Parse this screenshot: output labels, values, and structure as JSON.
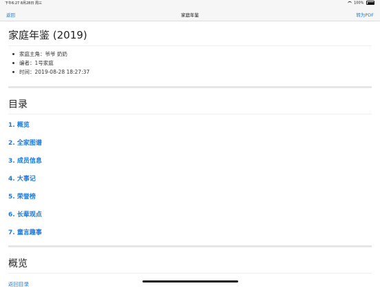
{
  "status_bar": {
    "time_date": "下午6:27  8月28日 周三",
    "battery_text": "100%"
  },
  "nav": {
    "back_label": "返回",
    "title": "家庭年鉴",
    "pdf_label": "转为PDF"
  },
  "document": {
    "title": "家庭年鉴 (2019)",
    "meta": [
      "家庭主角：爷爷 奶奶",
      "编者：1号家庭",
      "时间：2019-08-28 18:27:37"
    ]
  },
  "toc": {
    "heading": "目录",
    "items": [
      "1. 概览",
      "2. 全家图谱",
      "3. 成员信息",
      "4. 大事记",
      "5. 荣誉榜",
      "6. 长辈观点",
      "7. 童言趣事"
    ]
  },
  "overview": {
    "heading": "概览",
    "back_link": "返回目录"
  },
  "colors": {
    "link": "#1e7ad9",
    "bar_bg": "#f6f6f6"
  }
}
